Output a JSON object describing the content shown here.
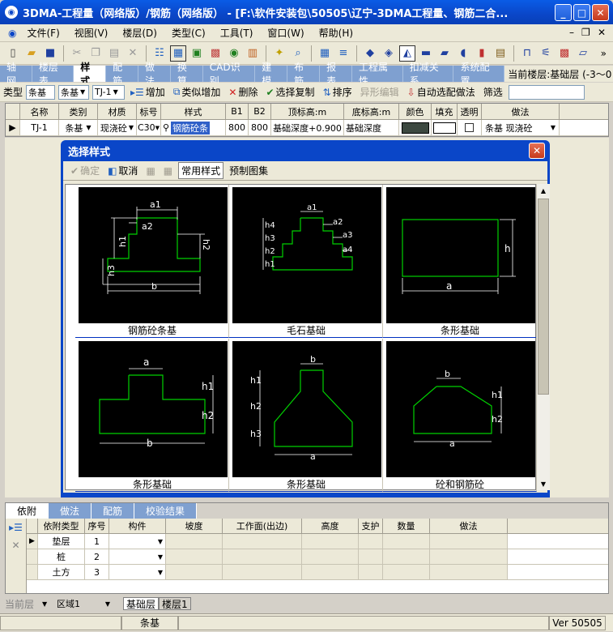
{
  "window": {
    "title": "3DMA-工程量（网络版）/钢筋（网络版） - [F:\\软件安装包\\50505\\辽宁-3DMA工程量、钢筋二合..."
  },
  "menu": [
    "文件(F)",
    "视图(V)",
    "楼层(D)",
    "类型(C)",
    "工具(T)",
    "窗口(W)",
    "帮助(H)"
  ],
  "tabs": [
    "轴网",
    "楼层表",
    "样式",
    "配筋",
    "做法",
    "换算",
    "CAD识别",
    "建模",
    "布筋",
    "报表",
    "工程属性",
    "扣减关系",
    "系统配置"
  ],
  "active_tab": "样式",
  "current_floor": "当前楼层:基础层 (-3～0",
  "subtoolbar": {
    "type_label": "类型",
    "type_value": "条基",
    "type2_value": "条基",
    "code_value": "TJ-1",
    "add": "增加",
    "similar_add": "类似增加",
    "delete": "删除",
    "select_copy": "选择复制",
    "sort": "排序",
    "shape_edit": "异形编辑",
    "auto_method": "自动选配做法",
    "filter": "筛选"
  },
  "grid": {
    "headers": [
      "名称",
      "类别",
      "材质",
      "标号",
      "样式",
      "B1",
      "B2",
      "顶标高:m",
      "底标高:m",
      "颜色",
      "填充",
      "透明",
      "做法"
    ],
    "row": {
      "name": "TJ-1",
      "category": "条基",
      "material": "现浇砼",
      "grade": "C30",
      "style": "钢筋砼条",
      "b1": "800",
      "b2": "800",
      "top": "基础深度+0.900",
      "bottom": "基础深度",
      "method": "条基 现浇砼"
    }
  },
  "dialog": {
    "title": "选择样式",
    "ok": "确定",
    "cancel": "取消",
    "common": "常用样式",
    "preset": "预制图集",
    "items": [
      {
        "caption": "钢筋砼条基",
        "labels": [
          "a1",
          "a2",
          "h1",
          "h2",
          "h3",
          "b"
        ]
      },
      {
        "caption": "毛石基础",
        "labels": [
          "a1",
          "a2",
          "a3",
          "a4",
          "h4",
          "h3",
          "h2",
          "h1"
        ]
      },
      {
        "caption": "条形基础",
        "labels": [
          "a",
          "h"
        ]
      },
      {
        "caption": "条形基础",
        "labels": [
          "a",
          "h1",
          "h2",
          "b"
        ]
      },
      {
        "caption": "条形基础",
        "labels": [
          "b",
          "h1",
          "h2",
          "h3",
          "a"
        ]
      },
      {
        "caption": "砼和钢筋砼",
        "labels": [
          "b",
          "h1",
          "h2",
          "a"
        ]
      }
    ]
  },
  "bottom": {
    "tabs": [
      "依附",
      "做法",
      "配筋",
      "校验结果"
    ],
    "headers": [
      "依附类型",
      "序号",
      "构件",
      "坡度",
      "工作面(出边)",
      "高度",
      "支护",
      "数量",
      "做法"
    ],
    "rows": [
      {
        "type": "垫层",
        "seq": "1"
      },
      {
        "type": "桩",
        "seq": "2"
      },
      {
        "type": "土方",
        "seq": "3"
      }
    ]
  },
  "status": {
    "floor_label": "当前层",
    "region": "区域1",
    "floor_tabs": [
      "基础层",
      "楼层1"
    ],
    "component": "条基",
    "version": "Ver 50505"
  },
  "colors": {
    "title_blue": "#0a46c8",
    "tab_blue": "#7fa0d0",
    "line_green": "#00d000",
    "color_cell": "#3c4840"
  }
}
